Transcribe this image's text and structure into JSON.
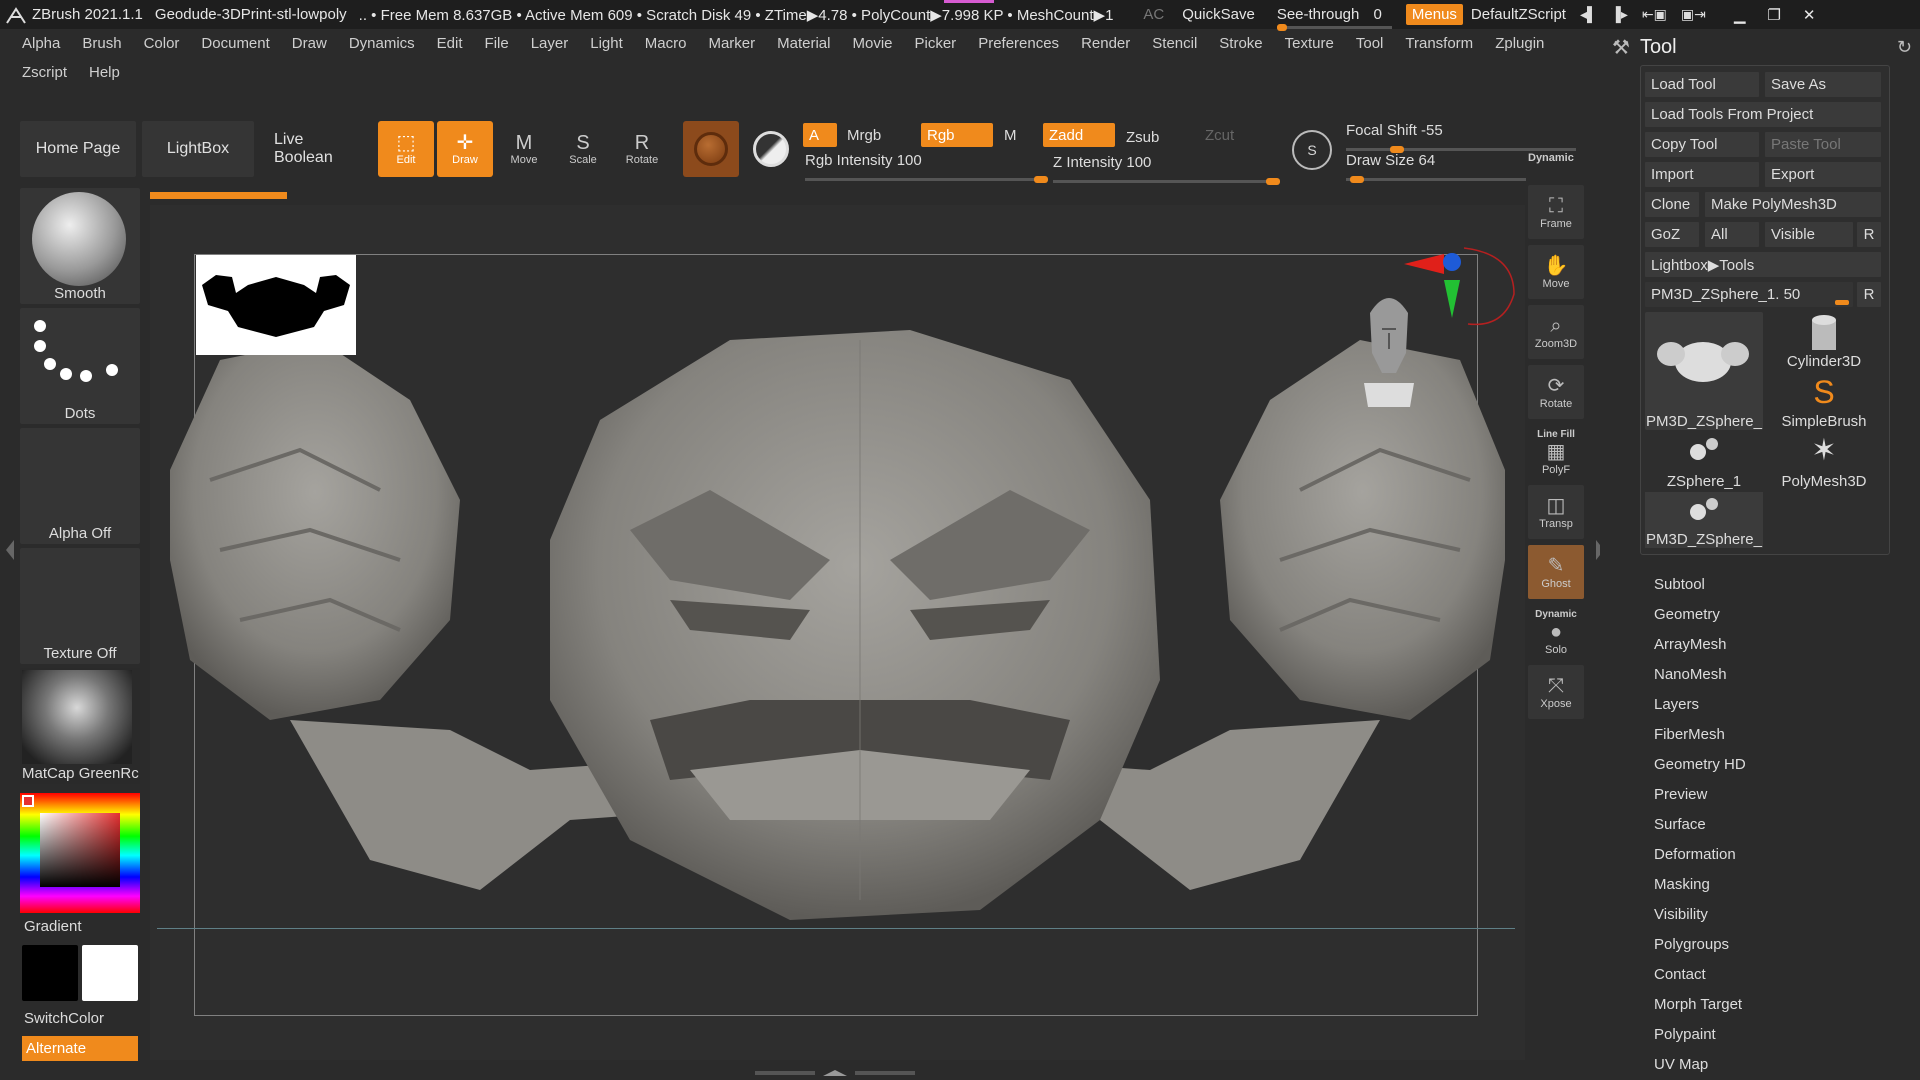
{
  "titlebar": {
    "app": "ZBrush 2021.1.1",
    "file": "Geodude-3DPrint-stl-lowpoly",
    "stats": ".. • Free Mem 8.637GB • Active Mem 609 • Scratch Disk 49 • ZTime▶4.78 • PolyCount▶7.998 KP • MeshCount▶1",
    "ac": "AC",
    "quicksave": "QuickSave",
    "see_through_label": "See-through",
    "see_through_value": "0",
    "menus": "Menus",
    "script": "DefaultZScript"
  },
  "menubar": {
    "row1": [
      "Alpha",
      "Brush",
      "Color",
      "Document",
      "Draw",
      "Dynamics",
      "Edit",
      "File",
      "Layer",
      "Light",
      "Macro",
      "Marker",
      "Material",
      "Movie",
      "Picker",
      "Preferences",
      "Render",
      "Stencil",
      "Stroke",
      "Texture",
      "Tool",
      "Transform",
      "Zplugin"
    ],
    "row2": [
      "Zscript",
      "Help"
    ]
  },
  "shelf": {
    "home": "Home Page",
    "lightbox": "LightBox",
    "live_boolean": "Live Boolean",
    "edit": "Edit",
    "draw": "Draw",
    "move": "Move",
    "scale": "Scale",
    "rotate": "Rotate"
  },
  "modes": {
    "a": "A",
    "mrgb": "Mrgb",
    "rgb": "Rgb",
    "m": "M",
    "zadd": "Zadd",
    "zsub": "Zsub",
    "zcut": "Zcut",
    "rgb_intensity_label": "Rgb Intensity",
    "rgb_intensity": "100",
    "z_intensity_label": "Z Intensity",
    "z_intensity": "100",
    "focal_shift_label": "Focal Shift",
    "focal_shift": "-55",
    "draw_size_label": "Draw Size",
    "draw_size": "64",
    "dynamic": "Dynamic",
    "rgb_intensity_level": 1.0,
    "z_intensity_level": 1.0,
    "focal_shift_level": 0.22,
    "draw_size_level": 0.06
  },
  "lefttray": {
    "smooth": "Smooth",
    "dots": "Dots",
    "alpha": "Alpha Off",
    "texture": "Texture Off",
    "matcap": "MatCap GreenRc",
    "gradient": "Gradient",
    "switch_color": "SwitchColor",
    "alternate": "Alternate"
  },
  "righttools": {
    "frame": "Frame",
    "move": "Move",
    "zoom3d": "Zoom3D",
    "rotate": "Rotate",
    "line_fill": "Line Fill",
    "polyf": "PolyF",
    "transp": "Transp",
    "ghost": "Ghost",
    "dynamic": "Dynamic",
    "solo": "Solo",
    "xpose": "Xpose"
  },
  "palette": {
    "title": "Tool",
    "load_tool": "Load Tool",
    "save_as": "Save As",
    "load_from_project": "Load Tools From Project",
    "copy_tool": "Copy Tool",
    "paste_tool": "Paste Tool",
    "import": "Import",
    "export": "Export",
    "clone": "Clone",
    "make_polymesh": "Make PolyMesh3D",
    "goz": "GoZ",
    "all": "All",
    "visible": "Visible",
    "r": "R",
    "lightbox_tools": "Lightbox▶Tools",
    "current_tool": "PM3D_ZSphere_1. 50",
    "tiles": {
      "pm3d_1": "PM3D_ZSphere_",
      "cylinder": "Cylinder3D",
      "simplebrush": "SimpleBrush",
      "zsphere": "ZSphere_1",
      "polymesh": "PolyMesh3D",
      "pm3d_2": "PM3D_ZSphere_"
    },
    "submenus": [
      "Subtool",
      "Geometry",
      "ArrayMesh",
      "NanoMesh",
      "Layers",
      "FiberMesh",
      "Geometry HD",
      "Preview",
      "Surface",
      "Deformation",
      "Masking",
      "Visibility",
      "Polygroups",
      "Contact",
      "Morph Target",
      "Polypaint",
      "UV Map"
    ]
  },
  "colors": {
    "accent": "#f08a1c",
    "background": "#2b2b2b",
    "panel": "#353535"
  }
}
